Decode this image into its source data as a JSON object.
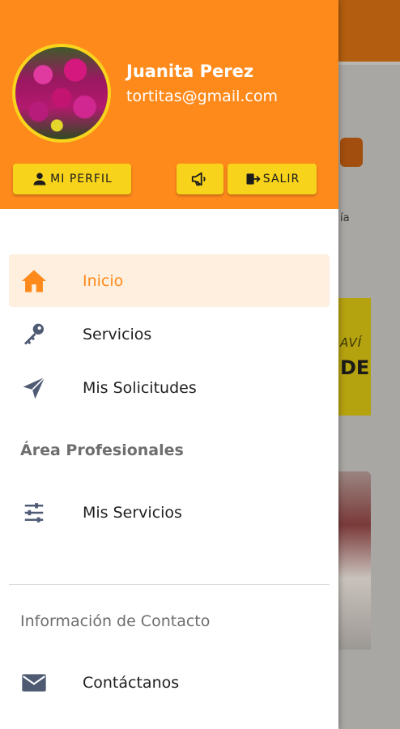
{
  "background": {
    "banner_line1": "AVÍ",
    "banner_line2": "DE",
    "tail_text": "ía"
  },
  "drawer": {
    "user": {
      "name": "Juanita Perez",
      "email": "tortitas@gmail.com"
    },
    "buttons": {
      "profile_label": "MI PERFIL",
      "logout_label": "SALIR"
    },
    "menu": [
      {
        "label": "Inicio",
        "icon": "home-icon",
        "active": true
      },
      {
        "label": "Servicios",
        "icon": "key-icon",
        "active": false
      },
      {
        "label": "Mis Solicitudes",
        "icon": "send-icon",
        "active": false
      }
    ],
    "section_professional": "Área Profesionales",
    "professional_menu": [
      {
        "label": "Mis Servicios",
        "icon": "sliders-icon"
      }
    ],
    "section_contact": "Información de Contacto",
    "contact_menu": [
      {
        "label": "Contáctanos",
        "icon": "mail-icon"
      }
    ]
  },
  "colors": {
    "accent": "#ff8a1c",
    "button": "#f8d31b",
    "active_bg": "#feefdf",
    "icon": "#4f5b73"
  }
}
